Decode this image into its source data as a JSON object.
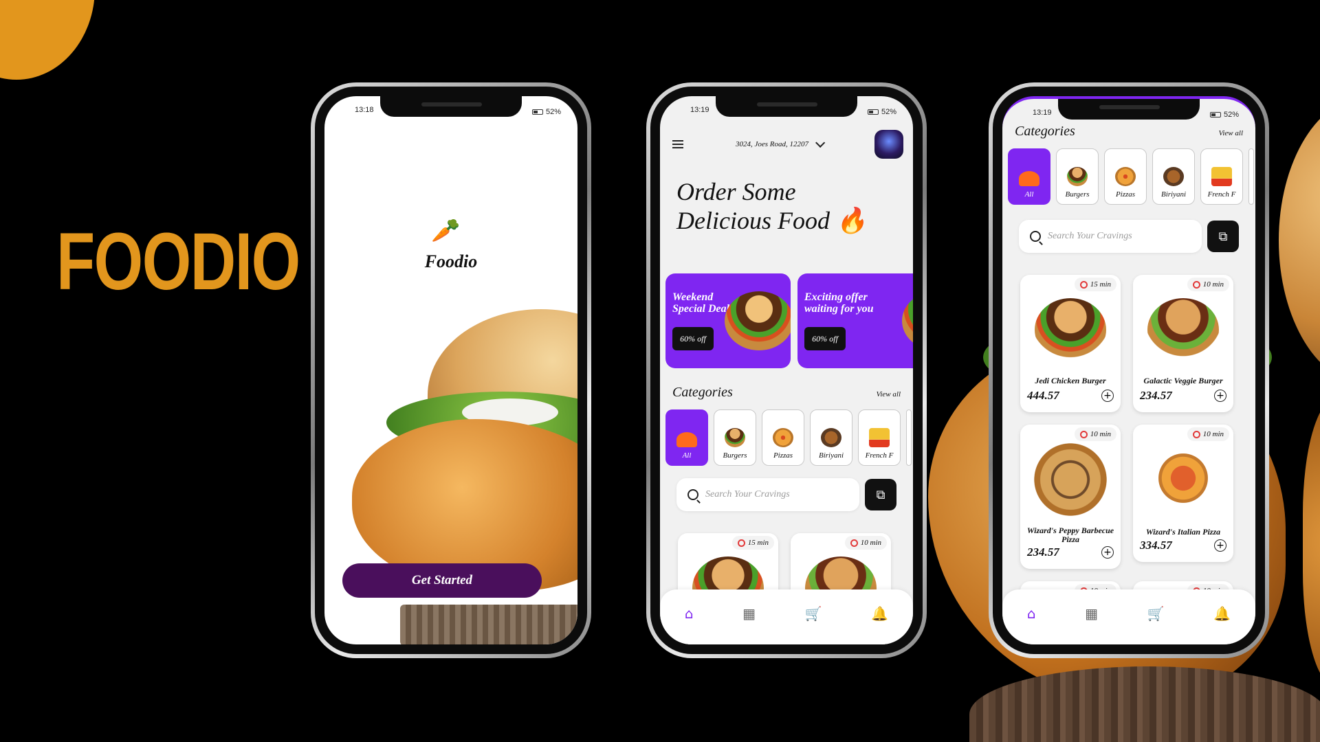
{
  "brand": {
    "title": "FOODIO",
    "accent": "#e2961d",
    "purple": "#7f26f1"
  },
  "phone1": {
    "status": {
      "time": "13:18",
      "battery": "52%"
    },
    "app_name": "Foodio",
    "logo_icon": "carrot-icon",
    "cta": "Get Started"
  },
  "phone2": {
    "status": {
      "time": "13:19",
      "battery": "52%"
    },
    "address": "3024, Joes Road, 12207",
    "hero_line1": "Order Some",
    "hero_line2": "Delicious Food",
    "deals": [
      {
        "title": "Weekend Special Deal",
        "badge": "60% off"
      },
      {
        "title": "Exciting offer waiting for you",
        "badge": "60% off"
      }
    ],
    "categories_title": "Categories",
    "view_all": "View all",
    "categories": [
      "All",
      "Burgers",
      "Pizzas",
      "Biriyani",
      "French F"
    ],
    "search_placeholder": "Search Your Cravings",
    "cards": [
      {
        "time": "15 min"
      },
      {
        "time": "10 min"
      }
    ]
  },
  "phone3": {
    "status": {
      "time": "13:19",
      "battery": "52%"
    },
    "categories_title": "Categories",
    "view_all": "View all",
    "categories": [
      "All",
      "Burgers",
      "Pizzas",
      "Biriyani",
      "French F"
    ],
    "search_placeholder": "Search Your Cravings",
    "cards": [
      {
        "name": "Jedi Chicken Burger",
        "price": "444.57",
        "time": "15 min"
      },
      {
        "name": "Galactic Veggie Burger",
        "price": "234.57",
        "time": "10 min"
      },
      {
        "name": "Wizard's Peppy Barbecue Pizza",
        "price": "234.57",
        "time": "10 min"
      },
      {
        "name": "Wizard's Italian Pizza",
        "price": "334.57",
        "time": "10 min"
      },
      {
        "time": "10 min"
      },
      {
        "time": "10 min"
      }
    ]
  },
  "nav": [
    "home-icon",
    "store-icon",
    "cart-icon",
    "bell-icon"
  ]
}
